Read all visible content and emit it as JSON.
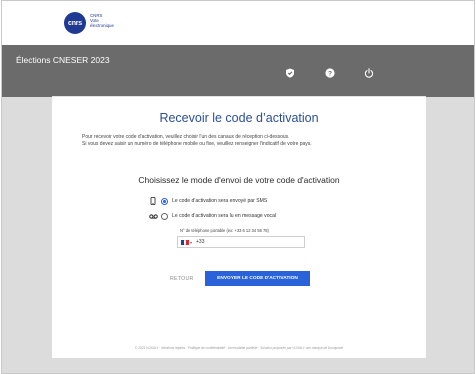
{
  "logo": {
    "mark": "cnrs",
    "line1": "CNRS",
    "line2": "Vote",
    "line3": "électronique"
  },
  "header": {
    "title": "Élections CNESER 2023"
  },
  "icons": {
    "shield": "shield-check-icon",
    "help": "help-icon",
    "power": "power-icon"
  },
  "card": {
    "title": "Recevoir le code d’activation",
    "intro_line1": "Pour recevoir votre code d'activation, veuillez choisir l'un des canaux de réception ci-dessous.",
    "intro_line2": "Si vous devez saisir un numéro de téléphone mobile ou fixe, veuillez renseigner l'indicatif de votre pays.",
    "mode_title": "Choisissez le mode d'envoi de votre code d'activation",
    "options": [
      {
        "label": "Le code d'activation sera envoyé par SMS",
        "icon": "mobile-phone-icon",
        "checked": true
      },
      {
        "label": "Le code d'activation sera lu en message vocal",
        "icon": "voicemail-icon",
        "checked": false
      }
    ],
    "phone_label": "N° de téléphone portable (ex: +33 6 12 34 56 78)",
    "phone_prefix": "+33",
    "back_label": "RETOUR",
    "submit_label": "ENVOYER LE CODE D'ACTIVATION"
  },
  "footer": {
    "text": "© 2023 VOXALY  ·  Mentions légales  ·  Politique de confidentialité  ·  Accessibilité partielle  ·  Solution proposée par VOXALY une marque de Docaposte"
  },
  "colors": {
    "accent": "#2962d9",
    "title": "#2a4f9b",
    "band": "#6b6b6b",
    "bg": "#dcdcdc"
  }
}
